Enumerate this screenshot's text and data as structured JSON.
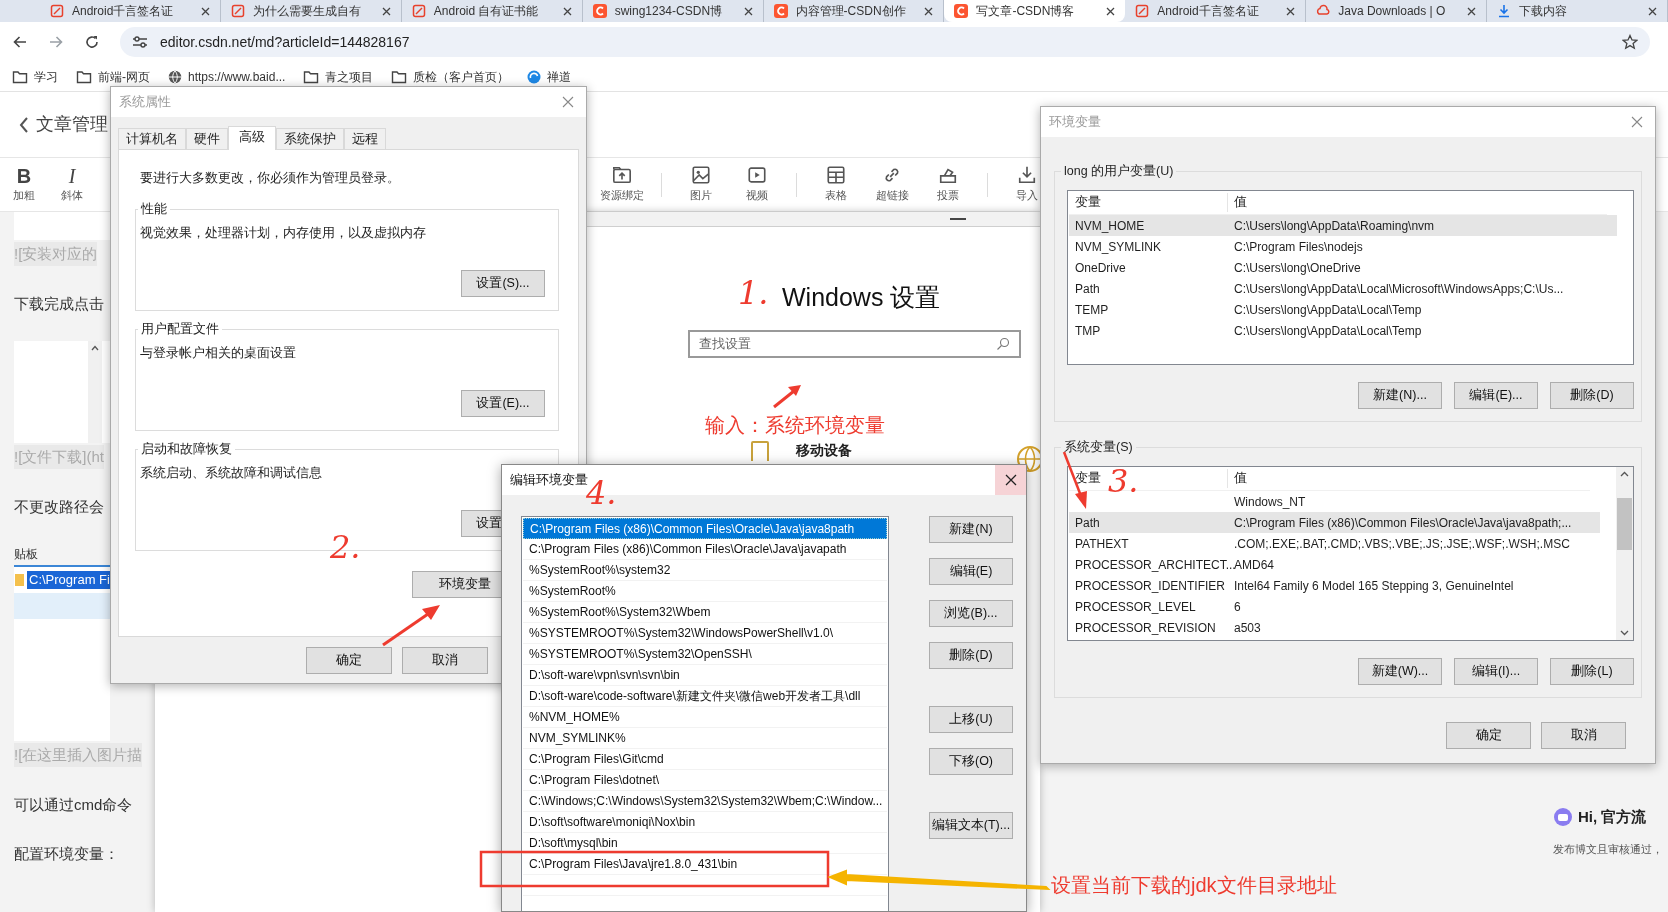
{
  "browser": {
    "tabs": [
      {
        "title": "Android千言签名证",
        "kind": "pen",
        "selected": false
      },
      {
        "title": "为什么需要生成自有",
        "kind": "pen",
        "selected": false
      },
      {
        "title": "Android 自有证书能",
        "kind": "pen",
        "selected": false
      },
      {
        "title": "swing1234-CSDN博",
        "kind": "c",
        "selected": false
      },
      {
        "title": "内容管理-CSDN创作",
        "kind": "c",
        "selected": false
      },
      {
        "title": "写文章-CSDN博客",
        "kind": "c",
        "selected": true
      },
      {
        "title": "Android千言签名证",
        "kind": "pen",
        "selected": false
      },
      {
        "title": "Java Downloads | O",
        "kind": "cloud",
        "selected": false
      },
      {
        "title": "下载内容",
        "kind": "download",
        "selected": false
      }
    ],
    "url": "editor.csdn.net/md?articleId=144828167",
    "bookmarks": [
      {
        "label": "学习",
        "kind": "folder"
      },
      {
        "label": "前端-网页",
        "kind": "folder"
      },
      {
        "label": "https://www.baid...",
        "kind": "globe"
      },
      {
        "label": "青之项目",
        "kind": "folder"
      },
      {
        "label": "质检（客户首页）",
        "kind": "folder"
      },
      {
        "label": "禅道",
        "kind": "zentao"
      }
    ]
  },
  "editor": {
    "back_label": "文章管理",
    "format_tools": [
      {
        "kind": "bold",
        "glyph": "B",
        "label": "加粗"
      },
      {
        "kind": "italic",
        "glyph": "I",
        "label": "斜体"
      }
    ],
    "insert_tool_groups": [
      [
        {
          "kind": "upload",
          "label": "资源绑定"
        }
      ],
      [
        {
          "kind": "image",
          "label": "图片"
        },
        {
          "kind": "video",
          "label": "视频"
        }
      ],
      [
        {
          "kind": "table",
          "label": "表格"
        },
        {
          "kind": "link",
          "label": "超链接"
        },
        {
          "kind": "vote",
          "label": "投票"
        }
      ],
      [
        {
          "kind": "import",
          "label": "导入"
        }
      ]
    ],
    "body": [
      {
        "kind": "image"
      },
      {
        "kind": "placeholder",
        "text": "![安装对应的"
      },
      {
        "kind": "paragraph",
        "text": "下载完成点击"
      },
      {
        "kind": "image_scroll"
      },
      {
        "kind": "placeholder",
        "text": "![文件下载](ht"
      },
      {
        "kind": "paragraph",
        "text": "不更改路径会"
      },
      {
        "kind": "clipboard",
        "label": "贴板",
        "path": "C:\\Program Fi"
      },
      {
        "kind": "placeholder",
        "text": "![在这里插入图片描"
      },
      {
        "kind": "paragraph",
        "text": "可以通过cmd命令"
      },
      {
        "kind": "paragraph",
        "text": "配置环境变量："
      }
    ],
    "side_title": "Hi, 官方流",
    "side_text": "发布博文且审核通过，"
  },
  "settings_window": {
    "heading": "Windows 设置",
    "search_placeholder": "查找设置",
    "items": [
      {
        "label": "移动设备"
      }
    ]
  },
  "system_properties": {
    "title": "系统属性",
    "tabs": [
      {
        "label": "计算机名",
        "selected": false
      },
      {
        "label": "硬件",
        "selected": false
      },
      {
        "label": "高级",
        "selected": true
      },
      {
        "label": "系统保护",
        "selected": false
      },
      {
        "label": "远程",
        "selected": false
      }
    ],
    "notice": "要进行大多数更改，你必须作为管理员登录。",
    "groups": [
      {
        "title": "性能",
        "text": "视觉效果，处理器计划，内存使用，以及虚拟内存",
        "button": "设置(S)..."
      },
      {
        "title": "用户配置文件",
        "text": "与登录帐户相关的桌面设置",
        "button": "设置(E)..."
      },
      {
        "title": "启动和故障恢复",
        "text": "系统启动、系统故障和调试信息",
        "button": "设置"
      }
    ],
    "env_button": "环境变量",
    "buttons": [
      "确定",
      "取消"
    ]
  },
  "environment_variables": {
    "title": "环境变量",
    "user_group": {
      "label": "long 的用户变量(U)",
      "columns": [
        "变量",
        "值"
      ],
      "rows": [
        {
          "variable": "NVM_HOME",
          "value": "C:\\Users\\long\\AppData\\Roaming\\nvm",
          "selected": true
        },
        {
          "variable": "NVM_SYMLINK",
          "value": "C:\\Program Files\\nodejs",
          "selected": false
        },
        {
          "variable": "OneDrive",
          "value": "C:\\Users\\long\\OneDrive",
          "selected": false
        },
        {
          "variable": "Path",
          "value": "C:\\Users\\long\\AppData\\Local\\Microsoft\\WindowsApps;C:\\Us...",
          "selected": false
        },
        {
          "variable": "TEMP",
          "value": "C:\\Users\\long\\AppData\\Local\\Temp",
          "selected": false
        },
        {
          "variable": "TMP",
          "value": "C:\\Users\\long\\AppData\\Local\\Temp",
          "selected": false
        }
      ],
      "buttons": [
        "新建(N)...",
        "编辑(E)...",
        "删除(D)"
      ]
    },
    "system_group": {
      "label": "系统变量(S)",
      "columns": [
        "变量",
        "值"
      ],
      "rows": [
        {
          "value": "Windows_NT",
          "selected": false
        },
        {
          "variable": "Path",
          "value": "C:\\Program Files (x86)\\Common Files\\Oracle\\Java\\java8path;...",
          "selected": true
        },
        {
          "variable": "PATHEXT",
          "value": ".COM;.EXE;.BAT;.CMD;.VBS;.VBE;.JS;.JSE;.WSF;.WSH;.MSC",
          "selected": false
        },
        {
          "variable": "PROCESSOR_ARCHITECT...",
          "value": "AMD64",
          "selected": false
        },
        {
          "variable": "PROCESSOR_IDENTIFIER",
          "value": "Intel64 Family 6 Model 165 Stepping 3, GenuineIntel",
          "selected": false
        },
        {
          "variable": "PROCESSOR_LEVEL",
          "value": "6",
          "selected": false
        },
        {
          "variable": "PROCESSOR_REVISION",
          "value": "a503",
          "selected": false
        }
      ],
      "buttons": [
        "新建(W)...",
        "编辑(I)...",
        "删除(L)"
      ]
    },
    "buttons": [
      "确定",
      "取消"
    ]
  },
  "edit_environment_variable": {
    "title": "编辑环境变量",
    "entries": [
      {
        "text": "C:\\Program Files (x86)\\Common Files\\Oracle\\Java\\java8path",
        "selected": true
      },
      {
        "text": "C:\\Program Files (x86)\\Common Files\\Oracle\\Java\\javapath",
        "selected": false
      },
      {
        "text": "%SystemRoot%\\system32",
        "selected": false
      },
      {
        "text": "%SystemRoot%",
        "selected": false
      },
      {
        "text": "%SystemRoot%\\System32\\Wbem",
        "selected": false
      },
      {
        "text": "%SYSTEMROOT%\\System32\\WindowsPowerShell\\v1.0\\",
        "selected": false
      },
      {
        "text": "%SYSTEMROOT%\\System32\\OpenSSH\\",
        "selected": false
      },
      {
        "text": "D:\\soft-ware\\vpn\\svn\\svn\\bin",
        "selected": false
      },
      {
        "text": "D:\\soft-ware\\code-software\\新建文件夹\\微信web开发者工具\\dll",
        "selected": false
      },
      {
        "text": "%NVM_HOME%",
        "selected": false
      },
      {
        "text": "NVM_SYMLINK%",
        "selected": false
      },
      {
        "text": "C:\\Program Files\\Git\\cmd",
        "selected": false
      },
      {
        "text": "C:\\Program Files\\dotnet\\",
        "selected": false
      },
      {
        "text": "C:\\Windows;C:\\Windows\\System32\\System32\\Wbem;C:\\Window...",
        "selected": false
      },
      {
        "text": "D:\\soft\\software\\moniqi\\Nox\\bin",
        "selected": false
      },
      {
        "text": "D:\\soft\\mysql\\bin",
        "selected": false
      },
      {
        "text": "C:\\Program Files\\Java\\jre1.8.0_431\\bin",
        "selected": false
      }
    ],
    "button_groups": [
      [
        "新建(N)",
        "编辑(E)",
        "浏览(B)...",
        "删除(D)"
      ],
      [
        "上移(U)",
        "下移(O)"
      ],
      [
        "编辑文本(T)..."
      ]
    ]
  },
  "annotations": [
    {
      "kind": "step",
      "text": "1."
    },
    {
      "kind": "step",
      "text": "2."
    },
    {
      "kind": "step",
      "text": "3."
    },
    {
      "kind": "step",
      "text": "4."
    },
    {
      "kind": "note",
      "text": "输入：系统环境变量"
    },
    {
      "kind": "note",
      "text": "设置当前下载的jdk文件目录地址"
    }
  ]
}
